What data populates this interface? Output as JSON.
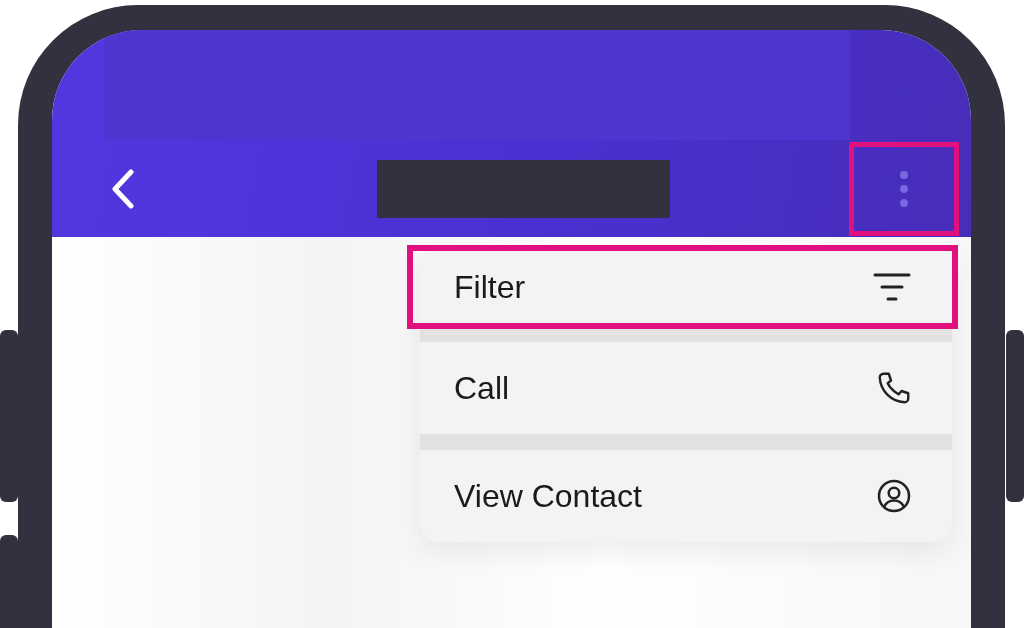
{
  "header": {
    "more_button": {
      "highlighted": true
    }
  },
  "menu": {
    "items": [
      {
        "label": "Filter",
        "kind": "filter",
        "highlighted": true
      },
      {
        "label": "Call",
        "kind": "phone",
        "highlighted": false
      },
      {
        "label": "View Contact",
        "kind": "contact",
        "highlighted": false
      }
    ]
  }
}
